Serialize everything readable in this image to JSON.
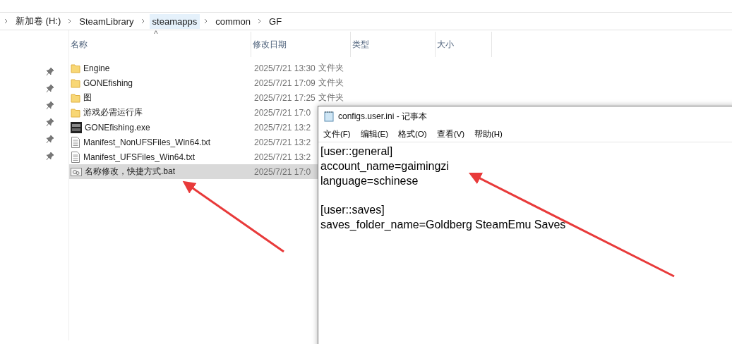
{
  "breadcrumb": [
    {
      "label": "新加卷 (H:)",
      "selected": false
    },
    {
      "label": "SteamLibrary",
      "selected": false
    },
    {
      "label": "steamapps",
      "selected": true
    },
    {
      "label": "common",
      "selected": false
    },
    {
      "label": "GF",
      "selected": false
    }
  ],
  "sort_indicator": "^",
  "columns": [
    "名称",
    "修改日期",
    "类型",
    "大小"
  ],
  "files": [
    {
      "kind": "folder",
      "name": "Engine",
      "date": "2025/7/21 13:30",
      "type": "文件夹",
      "selected": false
    },
    {
      "kind": "folder",
      "name": "GONEfishing",
      "date": "2025/7/21 17:09",
      "type": "文件夹",
      "selected": false
    },
    {
      "kind": "folder",
      "name": "图",
      "date": "2025/7/21 17:25",
      "type": "文件夹",
      "selected": false
    },
    {
      "kind": "folder",
      "name": "游戏必需运行库",
      "date": "2025/7/21 17:0",
      "selected": false
    },
    {
      "kind": "exe",
      "name": "GONEfishing.exe",
      "date": "2025/7/21 13:2",
      "selected": false
    },
    {
      "kind": "text",
      "name": "Manifest_NonUFSFiles_Win64.txt",
      "date": "2025/7/21 13:2",
      "selected": false
    },
    {
      "kind": "text",
      "name": "Manifest_UFSFiles_Win64.txt",
      "date": "2025/7/21 13:2",
      "selected": false
    },
    {
      "kind": "bat",
      "name": "名称修改，快捷方式.bat",
      "date": "2025/7/21 17:0",
      "selected": true
    }
  ],
  "notepad": {
    "title": "configs.user.ini - 记事本",
    "menu": [
      "文件(F)",
      "编辑(E)",
      "格式(O)",
      "查看(V)",
      "帮助(H)"
    ],
    "sections": [
      {
        "lines": [
          "[user::general]",
          "account_name=gaimingzi",
          "language=schinese"
        ]
      },
      {
        "lines": [
          "[user::saves]",
          "saves_folder_name=Goldberg SteamEmu Saves"
        ]
      }
    ]
  }
}
